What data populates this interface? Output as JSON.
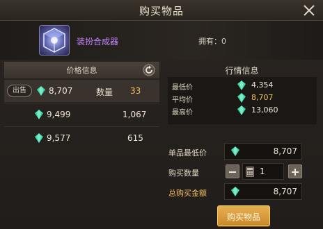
{
  "window": {
    "title": "购买物品"
  },
  "item": {
    "name": "装扮合成器",
    "owned_label": "拥有：0"
  },
  "left_panel": {
    "header": "价格信息",
    "sell_badge": "出售",
    "qty_label": "数量",
    "rows": [
      {
        "price": "8,707",
        "qty": "33",
        "selected": true
      },
      {
        "price": "9,499",
        "qty": "1,067",
        "selected": false
      },
      {
        "price": "9,577",
        "qty": "615",
        "selected": false
      }
    ]
  },
  "market": {
    "header": "行情信息",
    "lowest_label": "最低价",
    "lowest_value": "4,354",
    "average_label": "平均价",
    "average_value": "8,707",
    "highest_label": "最高价",
    "highest_value": "13,060"
  },
  "form": {
    "unit_price_label": "单品最低价",
    "unit_price_value": "8,707",
    "qty_label": "购买数量",
    "qty_value": "1",
    "total_label": "总购买金额",
    "total_value": "8,707"
  },
  "buttons": {
    "buy": "购买物品"
  },
  "colors": {
    "accent_gold": "#f0c060",
    "item_purple": "#c685ff",
    "gem_green": "#3fd8a8",
    "button_gold": "#d89a3a"
  },
  "icons": {
    "close": "close-icon",
    "refresh": "refresh-icon",
    "currency": "green-gem-icon",
    "item": "synthesizer-cube-icon"
  }
}
